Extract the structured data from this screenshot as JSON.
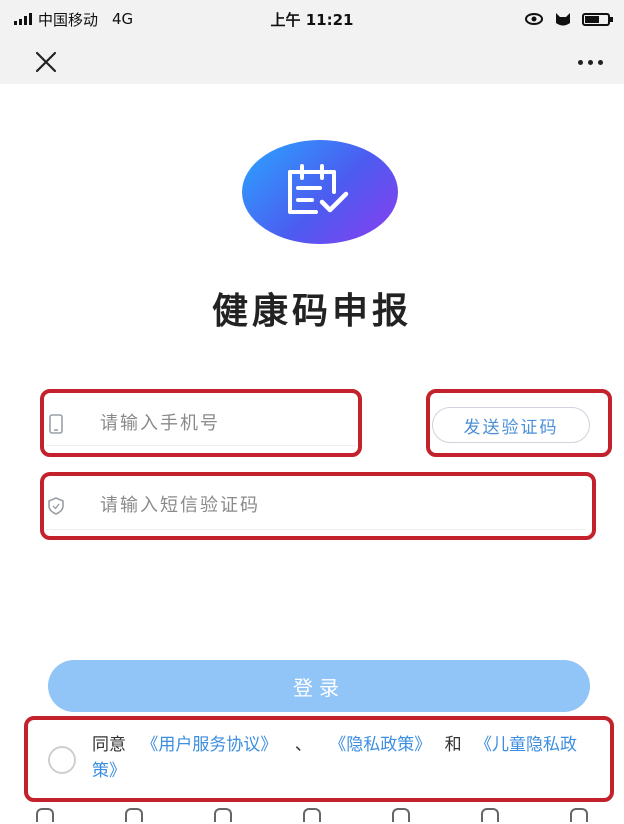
{
  "status_bar": {
    "carrier": "中国移动",
    "network": "4G",
    "time": "上午 11:21"
  },
  "nav": {
    "close_icon": "close-icon",
    "more_icon": "more-icon"
  },
  "app": {
    "title": "健康码申报",
    "logo_icon": "calendar-check-icon"
  },
  "form": {
    "phone_placeholder": "请输入手机号",
    "code_placeholder": "请输入短信验证码",
    "send_code_label": "发送验证码",
    "login_label": "登录"
  },
  "agreement": {
    "prefix": "同意",
    "link_user": "《用户服务协议》",
    "separator": "、",
    "link_privacy": "《隐私政策》",
    "conj": "和",
    "link_child": "《儿童隐私政策》"
  },
  "colors": {
    "accent": "#3c8ee0",
    "login_button": "#91c4f7",
    "highlight": "#c3222c"
  }
}
